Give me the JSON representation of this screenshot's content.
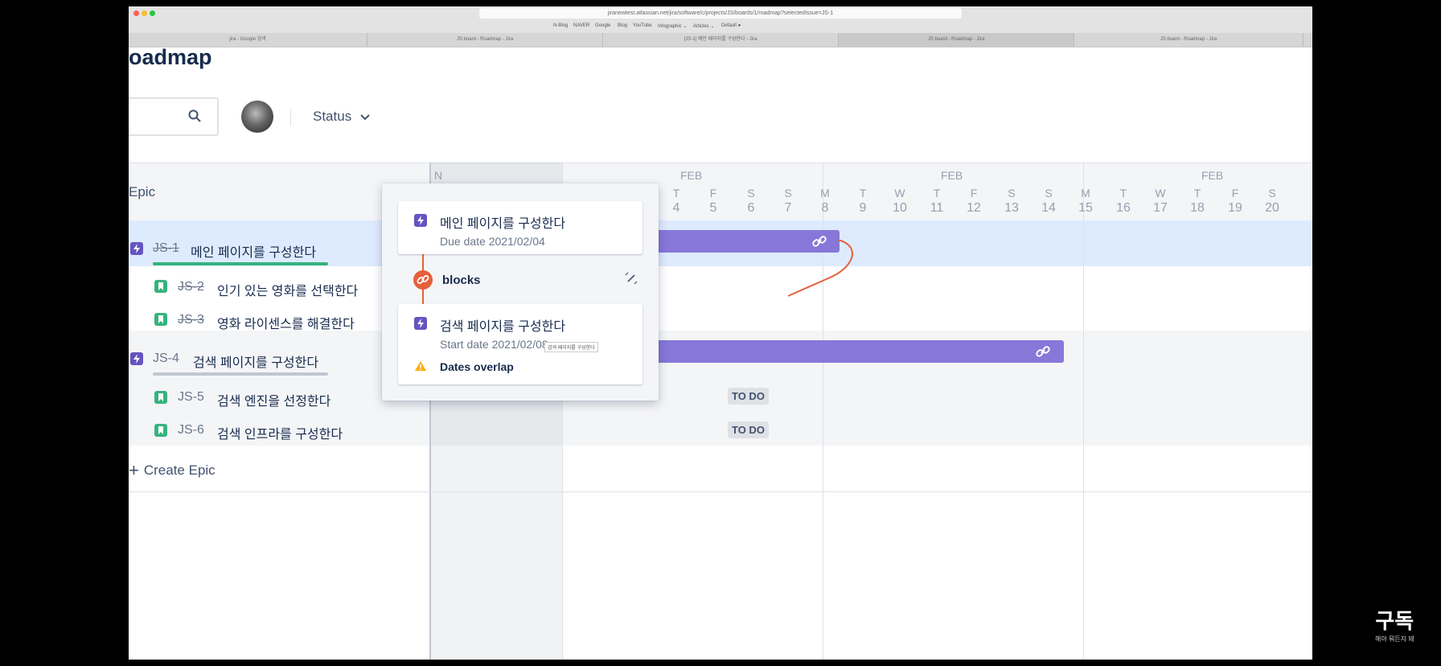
{
  "browser": {
    "url": "jiranewtest.atlassian.net/jira/software/c/projects/JS/boards/1/roadmap?selectedIssue=JS-1",
    "bookmarks": [
      "N-Blog",
      "NAVER",
      "Google",
      "Blog",
      "YouTube",
      "Infographic ⌄",
      "Articles ⌄",
      "Default ●"
    ],
    "tabs": [
      {
        "label": "jira - Google 검색",
        "active": false
      },
      {
        "label": "JS board - Roadmap - Jira",
        "active": false
      },
      {
        "label": "[JS-1] 메인 페이지를 구성한다 - Jira",
        "active": false
      },
      {
        "label": "JS board - Roadmap - Jira",
        "active": true
      },
      {
        "label": "JS board - Roadmap - Jira",
        "active": false
      }
    ]
  },
  "page": {
    "title": "oadmap",
    "status_filter": "Status"
  },
  "roadmap": {
    "epic_header": "Epic",
    "today_marker": "N",
    "months": [
      "FEB",
      "FEB",
      "FEB"
    ],
    "days": [
      {
        "name": "T",
        "num": "4"
      },
      {
        "name": "F",
        "num": "5"
      },
      {
        "name": "S",
        "num": "6"
      },
      {
        "name": "S",
        "num": "7"
      },
      {
        "name": "M",
        "num": "8"
      },
      {
        "name": "T",
        "num": "9"
      },
      {
        "name": "W",
        "num": "10"
      },
      {
        "name": "T",
        "num": "11"
      },
      {
        "name": "F",
        "num": "12"
      },
      {
        "name": "S",
        "num": "13"
      },
      {
        "name": "S",
        "num": "14"
      },
      {
        "name": "M",
        "num": "15"
      },
      {
        "name": "T",
        "num": "16"
      },
      {
        "name": "W",
        "num": "17"
      },
      {
        "name": "T",
        "num": "18"
      },
      {
        "name": "F",
        "num": "19"
      },
      {
        "name": "S",
        "num": "20"
      }
    ],
    "rows": [
      {
        "type": "epic",
        "key": "JS-1",
        "summary": "메인 페이지를 구성한다",
        "done": true,
        "progress": 1.0
      },
      {
        "type": "story",
        "key": "JS-2",
        "summary": "인기 있는 영화를 선택한다",
        "done": true
      },
      {
        "type": "story",
        "key": "JS-3",
        "summary": "영화 라이센스를 해결한다",
        "done": true
      },
      {
        "type": "epic",
        "key": "JS-4",
        "summary": "검색 페이지를 구성한다",
        "done": false,
        "progress": 0.0
      },
      {
        "type": "story",
        "key": "JS-5",
        "summary": "검색 엔진을 선정한다",
        "done": false,
        "status": "TO DO"
      },
      {
        "type": "story",
        "key": "JS-6",
        "summary": "검색 인프라를 구성한다",
        "done": false,
        "status": "TO DO"
      }
    ],
    "create_epic": "Create Epic"
  },
  "popup": {
    "source": {
      "title": "메인 페이지를 구성한다",
      "subtitle": "Due date 2021/02/04"
    },
    "relation": "blocks",
    "target": {
      "title": "검색 페이지를 구성한다",
      "subtitle": "Start date 2021/02/08",
      "warning": "Dates overlap"
    },
    "tooltip": "검색 페이지를 구성한다"
  },
  "watermark": {
    "title": "구독",
    "subtitle": "해야 뭐든지 돼"
  },
  "colors": {
    "epic": "#6554c0",
    "story": "#36b37e",
    "bar": "#8777d9",
    "link": "#e5603a",
    "warning": "#ffab00"
  }
}
